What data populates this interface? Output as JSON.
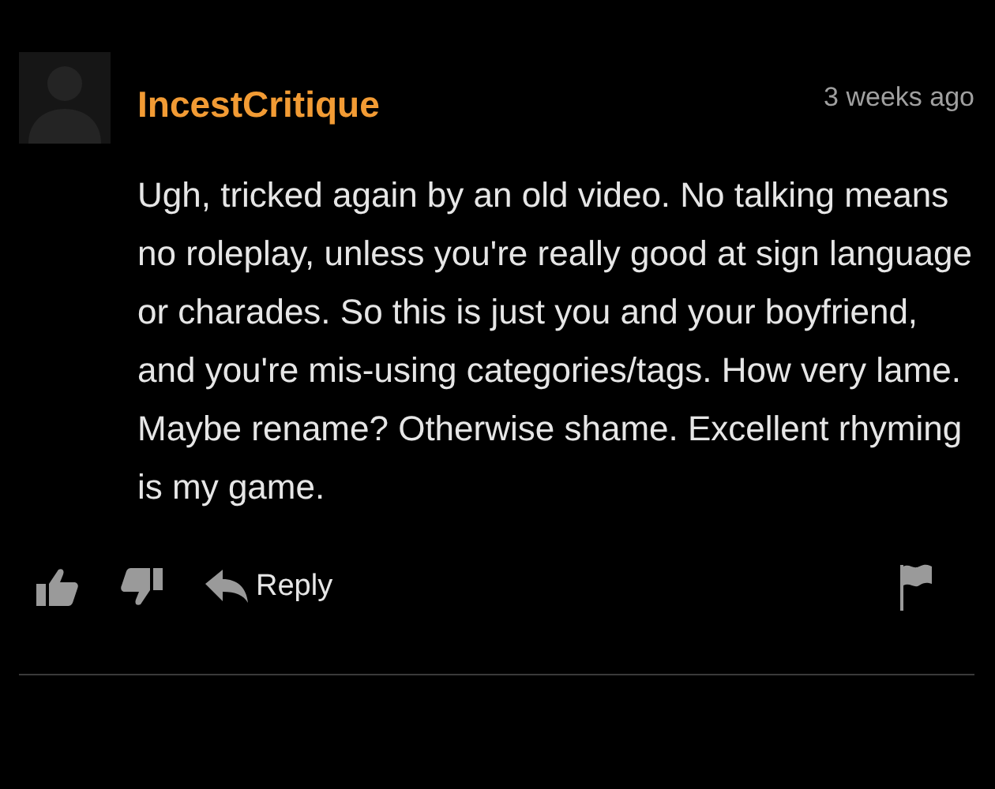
{
  "comment": {
    "author": "IncestCritique",
    "time": "3 weeks ago",
    "body": "Ugh, tricked again by an old video. No talking means no roleplay, unless you're really good at sign language or charades. So this is just you and your boyfriend, and you're mis-using categories/tags. How very lame. Maybe rename? Otherwise shame. Excellent rhyming is my game.",
    "actions": [
      {
        "kind": "like"
      },
      {
        "kind": "dislike"
      },
      {
        "kind": "reply",
        "label": "Reply"
      },
      {
        "kind": "flag"
      }
    ]
  }
}
